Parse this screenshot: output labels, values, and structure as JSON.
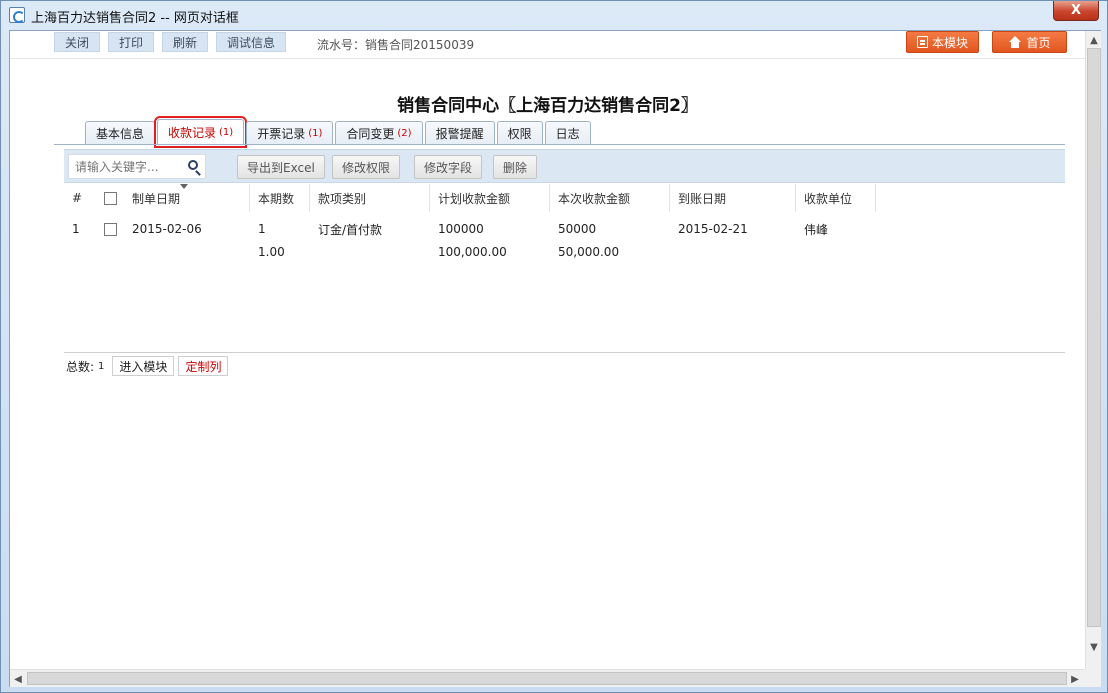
{
  "window": {
    "title": "上海百力达销售合同2 -- 网页对话框",
    "close_label": "X"
  },
  "topbar": {
    "buttons": [
      "关闭",
      "打印",
      "刷新",
      "调试信息"
    ],
    "serial_label": "流水号：",
    "serial_value": "销售合同20150039",
    "module_button": "本模块",
    "home_button": "首页"
  },
  "page": {
    "title": "销售合同中心〖上海百力达销售合同2〗"
  },
  "tabs": [
    {
      "label": "基本信息",
      "count": ""
    },
    {
      "label": "收款记录",
      "count": "(1)"
    },
    {
      "label": "开票记录",
      "count": "(1)"
    },
    {
      "label": "合同变更",
      "count": "(2)"
    },
    {
      "label": "报警提醒",
      "count": ""
    },
    {
      "label": "权限",
      "count": ""
    },
    {
      "label": "日志",
      "count": ""
    }
  ],
  "toolbar": {
    "search_placeholder": "请输入关键字...",
    "export_label": "导出到Excel",
    "edit_perm_label": "修改权限",
    "edit_field_label": "修改字段",
    "delete_label": "删除"
  },
  "grid": {
    "columns": [
      "#",
      "制单日期",
      "本期数",
      "款项类别",
      "计划收款金额",
      "本次收款金额",
      "到账日期",
      "收款单位"
    ],
    "rows": [
      {
        "index": "1",
        "date": "2015-02-06",
        "period": "1",
        "period_sub": "1.00",
        "category": "订金/首付款",
        "planned": "100000",
        "planned_sub": "100,000.00",
        "received": "50000",
        "received_sub": "50,000.00",
        "arrival_date": "2015-02-21",
        "unit": "伟峰"
      }
    ]
  },
  "footer": {
    "total_label": "总数:",
    "total_value": "1",
    "enter_module": "进入模块",
    "custom_columns": "定制列"
  }
}
